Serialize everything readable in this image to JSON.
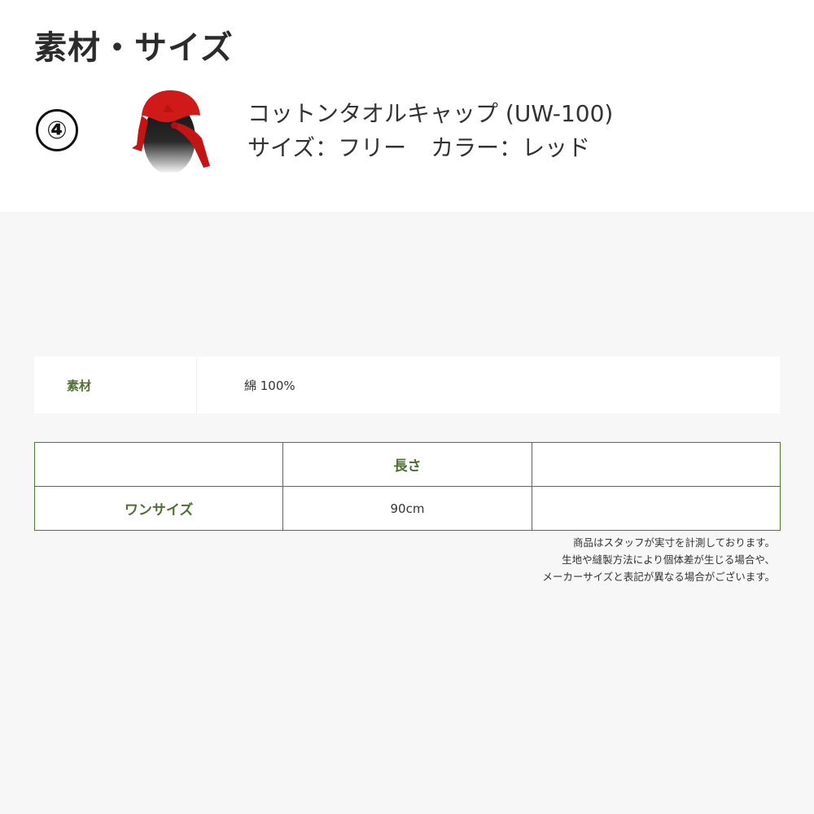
{
  "header": {
    "title": "素材・サイズ"
  },
  "product": {
    "number": "④",
    "name": "コットンタオルキャップ (UW-100)",
    "size_text": "サイズ：フリー",
    "color_text": "カラー：レッド"
  },
  "material": {
    "label": "素材",
    "value": "綿 100%"
  },
  "size_table": {
    "headers": [
      "",
      "長さ",
      ""
    ],
    "rows": [
      {
        "label": "ワンサイズ",
        "length": "90cm",
        "extra": ""
      }
    ]
  },
  "notes": [
    "商品はスタッフが実寸を計測しております。",
    "生地や縫製方法により個体差が生じる場合や、",
    "メーカーサイズと表記が異なる場合がございます。"
  ],
  "colors": {
    "accent_green": "#4a7a2a",
    "label_green": "#4f6f35",
    "cap_red": "#d01a1a"
  }
}
